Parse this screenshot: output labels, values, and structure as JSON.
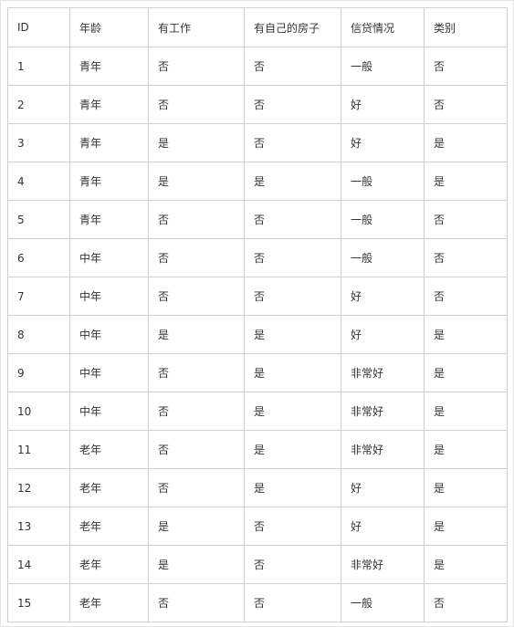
{
  "table": {
    "headers": [
      "ID",
      "年龄",
      "有工作",
      "有自己的房子",
      "信贷情况",
      "类别"
    ],
    "rows": [
      [
        "1",
        "青年",
        "否",
        "否",
        "一般",
        "否"
      ],
      [
        "2",
        "青年",
        "否",
        "否",
        "好",
        "否"
      ],
      [
        "3",
        "青年",
        "是",
        "否",
        "好",
        "是"
      ],
      [
        "4",
        "青年",
        "是",
        "是",
        "一般",
        "是"
      ],
      [
        "5",
        "青年",
        "否",
        "否",
        "一般",
        "否"
      ],
      [
        "6",
        "中年",
        "否",
        "否",
        "一般",
        "否"
      ],
      [
        "7",
        "中年",
        "否",
        "否",
        "好",
        "否"
      ],
      [
        "8",
        "中年",
        "是",
        "是",
        "好",
        "是"
      ],
      [
        "9",
        "中年",
        "否",
        "是",
        "非常好",
        "是"
      ],
      [
        "10",
        "中年",
        "否",
        "是",
        "非常好",
        "是"
      ],
      [
        "11",
        "老年",
        "否",
        "是",
        "非常好",
        "是"
      ],
      [
        "12",
        "老年",
        "否",
        "是",
        "好",
        "是"
      ],
      [
        "13",
        "老年",
        "是",
        "否",
        "好",
        "是"
      ],
      [
        "14",
        "老年",
        "是",
        "否",
        "非常好",
        "是"
      ],
      [
        "15",
        "老年",
        "否",
        "否",
        "一般",
        "否"
      ]
    ]
  },
  "colors": {
    "border": "#cfcfcf",
    "frame_border": "#e3e3e3",
    "text": "#333333",
    "background": "#ffffff"
  }
}
